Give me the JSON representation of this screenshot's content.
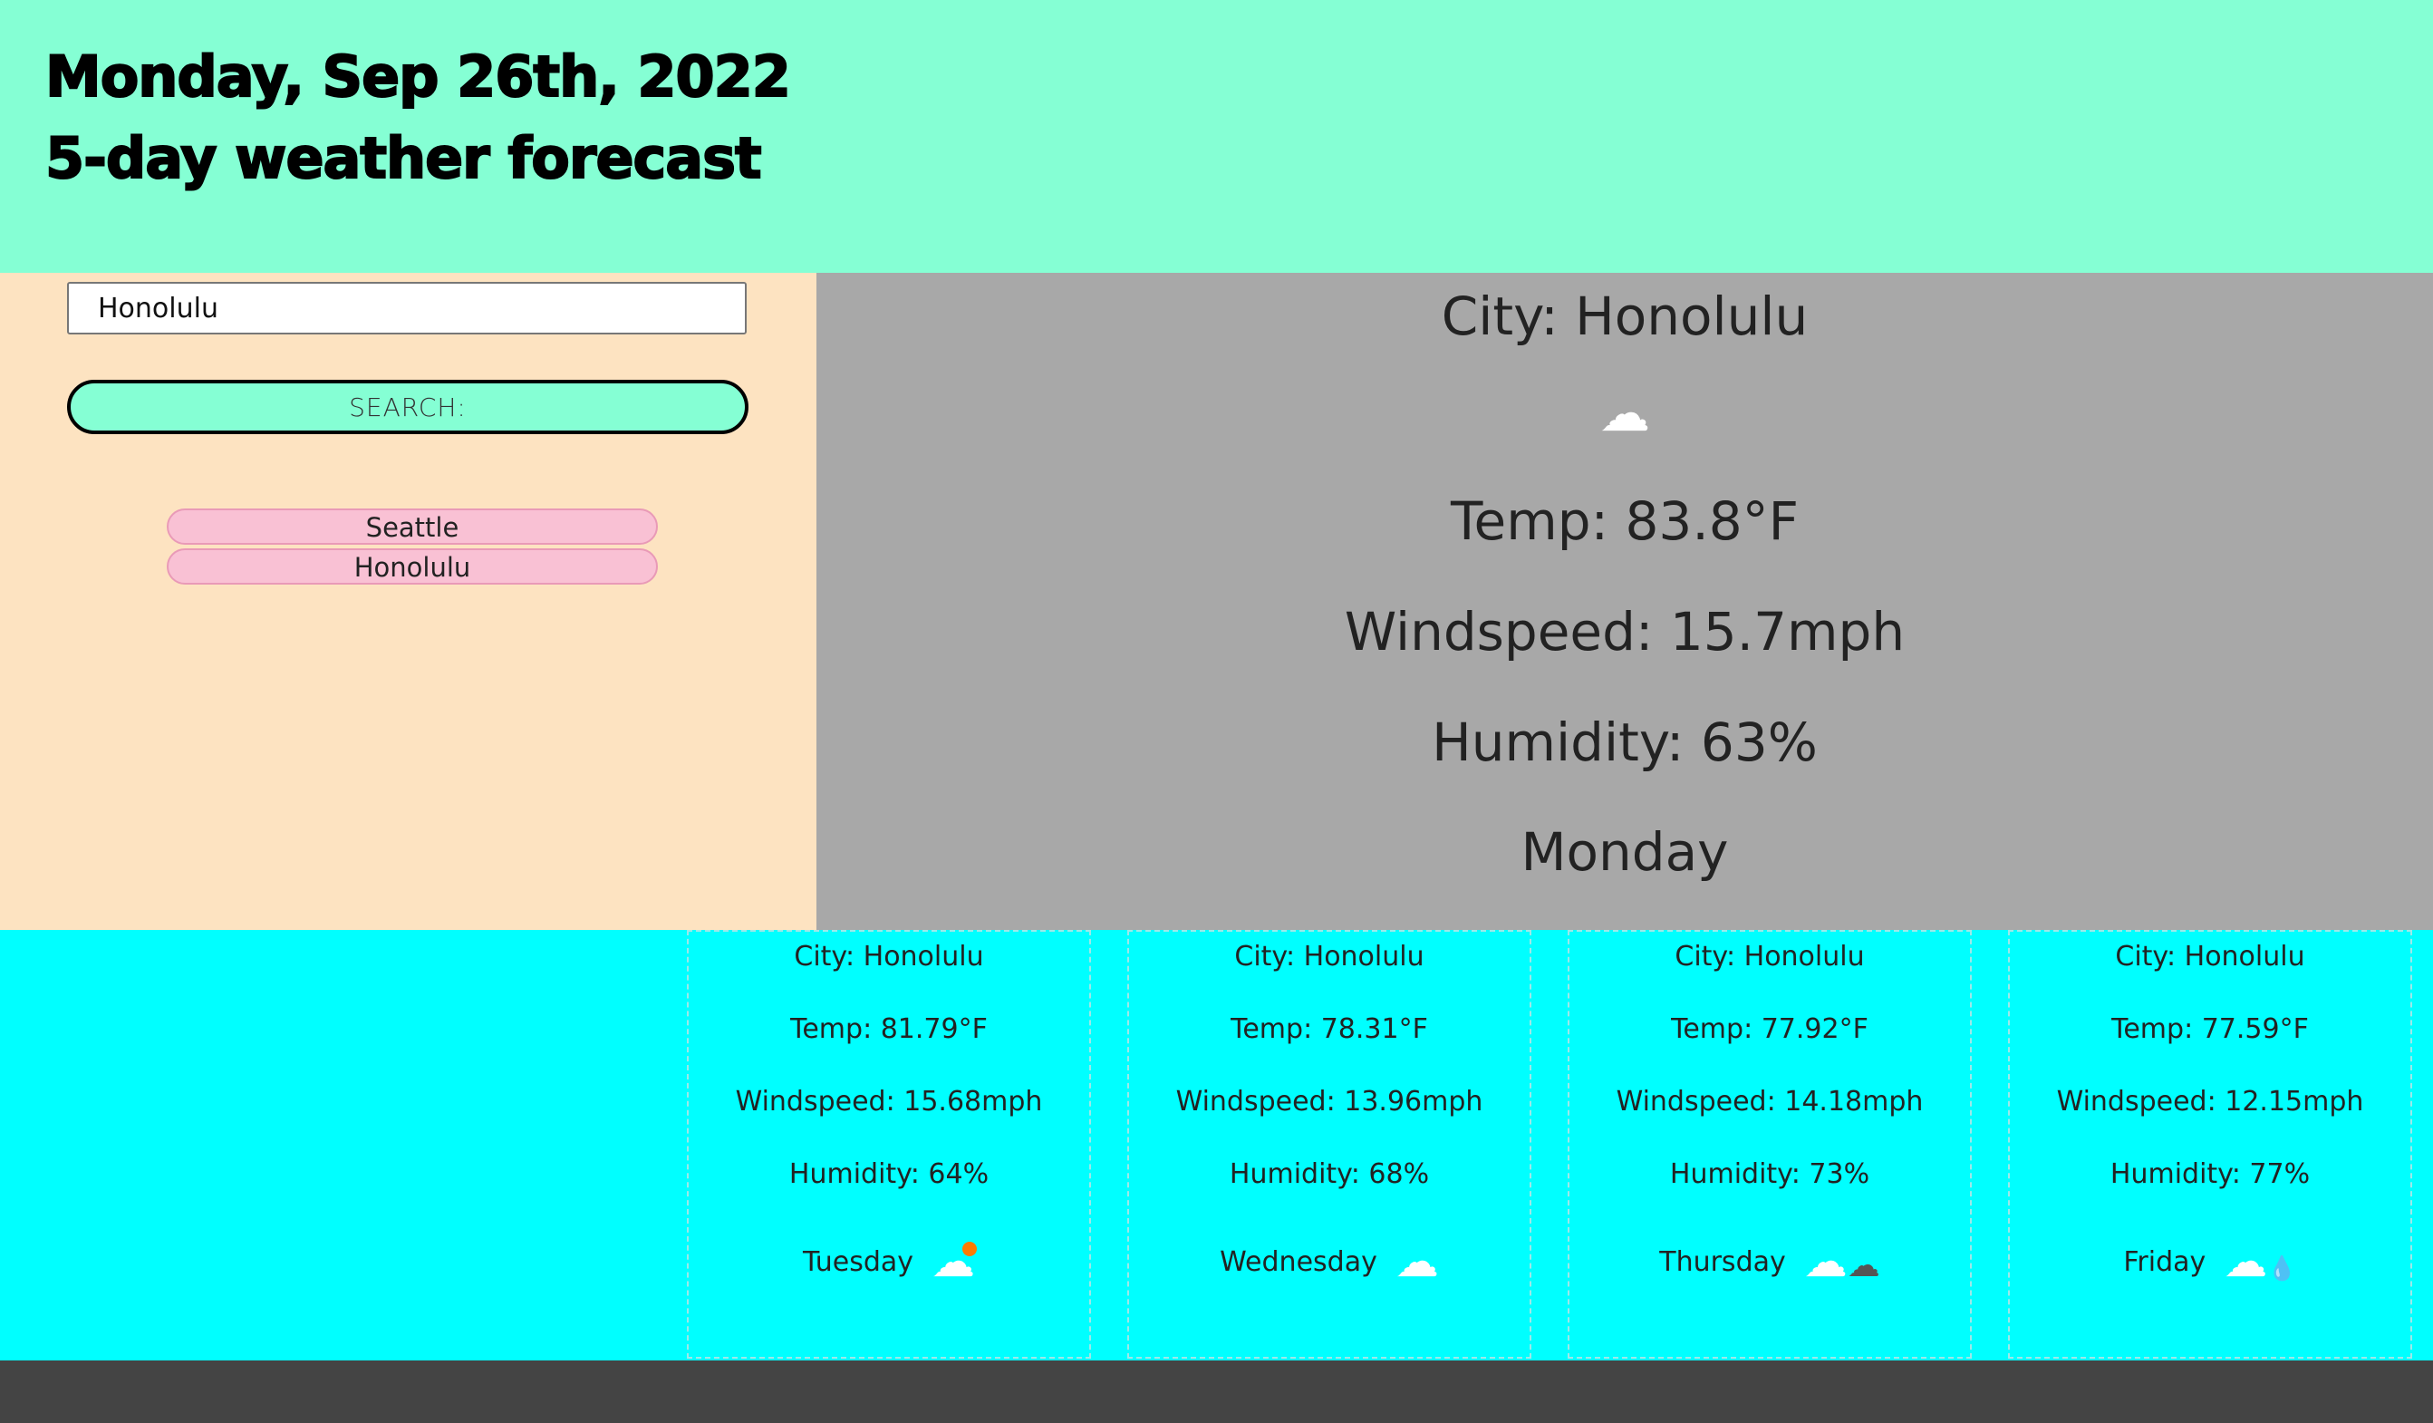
{
  "header": {
    "date": "Monday, Sep 26th, 2022",
    "subtitle": "5-day weather forecast"
  },
  "search": {
    "value": "Honolulu",
    "button_label": "SEARCH:"
  },
  "history": [
    "Seattle",
    "Honolulu"
  ],
  "current": {
    "city": "City: Honolulu",
    "icon": "cloud-icon",
    "temp": "Temp: 83.8°F",
    "wind": "Windspeed: 15.7mph",
    "humidity": "Humidity: 63%",
    "day": "Monday"
  },
  "forecast": [
    {
      "city": "City: Honolulu",
      "temp": "Temp: 81.79°F",
      "wind": "Windspeed: 15.68mph",
      "humidity": "Humidity: 64%",
      "day": "Tuesday",
      "icon": "partly-sunny-icon"
    },
    {
      "city": "City: Honolulu",
      "temp": "Temp: 78.31°F",
      "wind": "Windspeed: 13.96mph",
      "humidity": "Humidity: 68%",
      "day": "Wednesday",
      "icon": "cloud-icon"
    },
    {
      "city": "City: Honolulu",
      "temp": "Temp: 77.92°F",
      "wind": "Windspeed: 14.18mph",
      "humidity": "Humidity: 73%",
      "day": "Thursday",
      "icon": "broken-clouds-icon"
    },
    {
      "city": "City: Honolulu",
      "temp": "Temp: 77.59°F",
      "wind": "Windspeed: 12.15mph",
      "humidity": "Humidity: 77%",
      "day": "Friday",
      "icon": "rain-icon"
    }
  ],
  "colors": {
    "header_bg": "#85ffd4",
    "sidebar_bg": "#fde3c1",
    "current_bg": "#a8a8a8",
    "forecast_bg": "#00ffff",
    "history_bg": "#f9c1d4",
    "footer_bg": "#444444"
  }
}
